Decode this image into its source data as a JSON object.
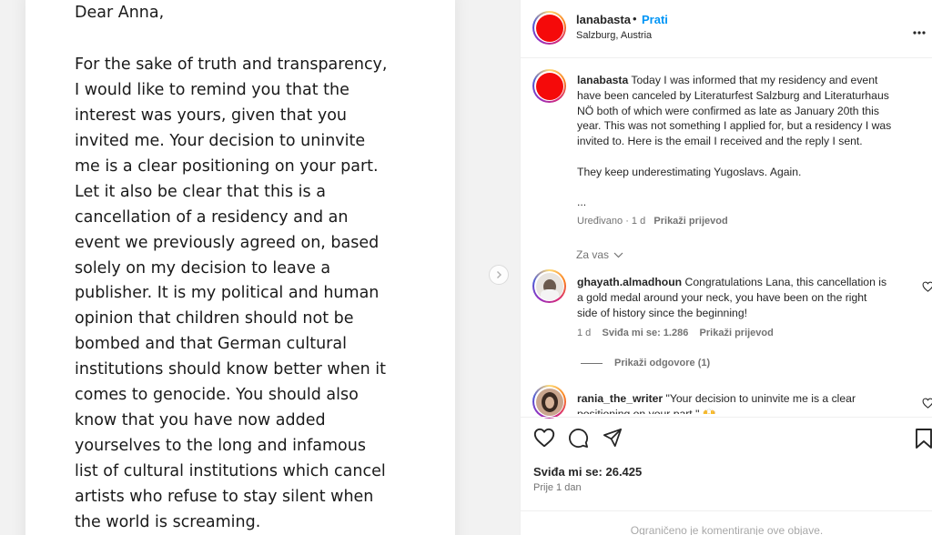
{
  "letter": {
    "greeting": "Dear Anna,",
    "lines": [
      "For the sake of truth and transparency,",
      "I would like to remind you that the",
      "interest was yours, given that you",
      "invited me. Your decision to uninvite",
      "me is a clear positioning on your part.",
      "Let it also be clear that this is a",
      "cancellation of a residency and an",
      "event we previously agreed on, based",
      "solely on my decision to leave a",
      "publisher. It is my political and human",
      "opinion that children should not be",
      "bombed and that German cultural",
      "institutions should know better when it",
      "comes to genocide. You should also",
      "know that you have now added",
      "yourselves to the long and infamous",
      "list of cultural institutions which cancel",
      "artists who refuse to stay silent when",
      "the world is screaming."
    ]
  },
  "header": {
    "username": "lanabasta",
    "separator": "•",
    "follow_label": "Prati",
    "location": "Salzburg, Austria",
    "avatar_color": "#f50a0a"
  },
  "caption": {
    "username": "lanabasta",
    "lines": [
      " Today I was informed that my residency and event",
      "have been canceled by Literaturfest Salzburg and Literaturhaus",
      "NÖ both of which were confirmed as late as January 20th this",
      "year. This was not something I applied for, but a residency I was",
      "invited to. Here is the email I received and the reply I sent."
    ],
    "line2": "They keep underestimating Yugoslavs. Again.",
    "ellipsis": "...",
    "edited": "Uređivano · 1 d",
    "translate": "Prikaži prijevod"
  },
  "filter_label": "Za vas",
  "comments": [
    {
      "username": "ghayath.almadhoun",
      "lines": [
        " Congratulations Lana, this cancellation is",
        "a gold medal around your neck, you have been on the right",
        "side of history since the beginning!"
      ],
      "age": "1 d",
      "likes": "Sviđa mi se: 1.286",
      "translate": "Prikaži prijevod",
      "replies": "Prikaži odgovore (1)"
    },
    {
      "username": "rania_the_writer",
      "lines": [
        " \"Your decision to uninvite me is a clear",
        "positioning on your part.\" 🙌"
      ]
    }
  ],
  "footer": {
    "likes": "Sviđa mi se: 26.425",
    "time": "Prije 1 dan",
    "restricted": "Ograničeno je komentiranje ove objave."
  },
  "icons": {
    "like": "heart-icon",
    "comment": "comment-icon",
    "share": "share-icon",
    "save": "bookmark-icon",
    "more": "more-horizontal-icon",
    "next": "chevron-right-icon"
  }
}
